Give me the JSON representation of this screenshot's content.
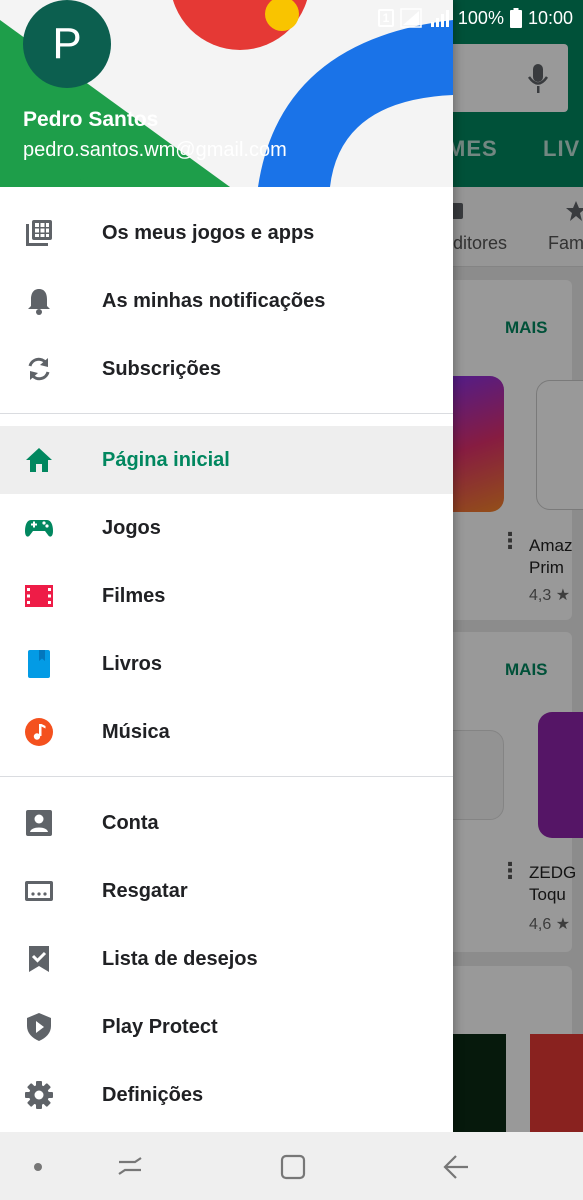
{
  "status_bar": {
    "sim_slot": "1",
    "battery": "100%",
    "time": "10:00"
  },
  "drawer": {
    "avatar_letter": "P",
    "account_name": "Pedro Santos",
    "account_email": "pedro.santos.wm@gmail.com",
    "section_personal": [
      {
        "label": "Os meus jogos e apps",
        "icon": "apps-grid-icon"
      },
      {
        "label": "As minhas notificações",
        "icon": "bell-icon"
      },
      {
        "label": "Subscrições",
        "icon": "refresh-icon"
      }
    ],
    "section_store": [
      {
        "label": "Página inicial",
        "icon": "home-icon",
        "selected": true
      },
      {
        "label": "Jogos",
        "icon": "gamepad-icon"
      },
      {
        "label": "Filmes",
        "icon": "film-icon"
      },
      {
        "label": "Livros",
        "icon": "book-icon"
      },
      {
        "label": "Música",
        "icon": "music-icon"
      }
    ],
    "section_settings": [
      {
        "label": "Conta",
        "icon": "account-icon"
      },
      {
        "label": "Resgatar",
        "icon": "redeem-icon"
      },
      {
        "label": "Lista de desejos",
        "icon": "wishlist-icon"
      },
      {
        "label": "Play Protect",
        "icon": "shield-icon"
      },
      {
        "label": "Definições",
        "icon": "gear-icon"
      }
    ]
  },
  "background": {
    "tabs": [
      "MES",
      "LIV"
    ],
    "chips": [
      "ditores",
      "Fam"
    ],
    "more_label_1": "MAIS",
    "more_label_2": "MAIS",
    "app1_name_line1": "Amaz",
    "app1_name_line2": "Prim",
    "app1_rating": "4,3 ★",
    "app2_name_line1": "ZEDG",
    "app2_name_line2": "Toqu",
    "app2_rating": "4,6 ★"
  },
  "colors": {
    "accent": "#01875f",
    "avatar": "#0c5f4f",
    "movies": "#ee1c47",
    "books": "#039be5",
    "music": "#f4511e",
    "icon_grey": "#5f6368"
  }
}
